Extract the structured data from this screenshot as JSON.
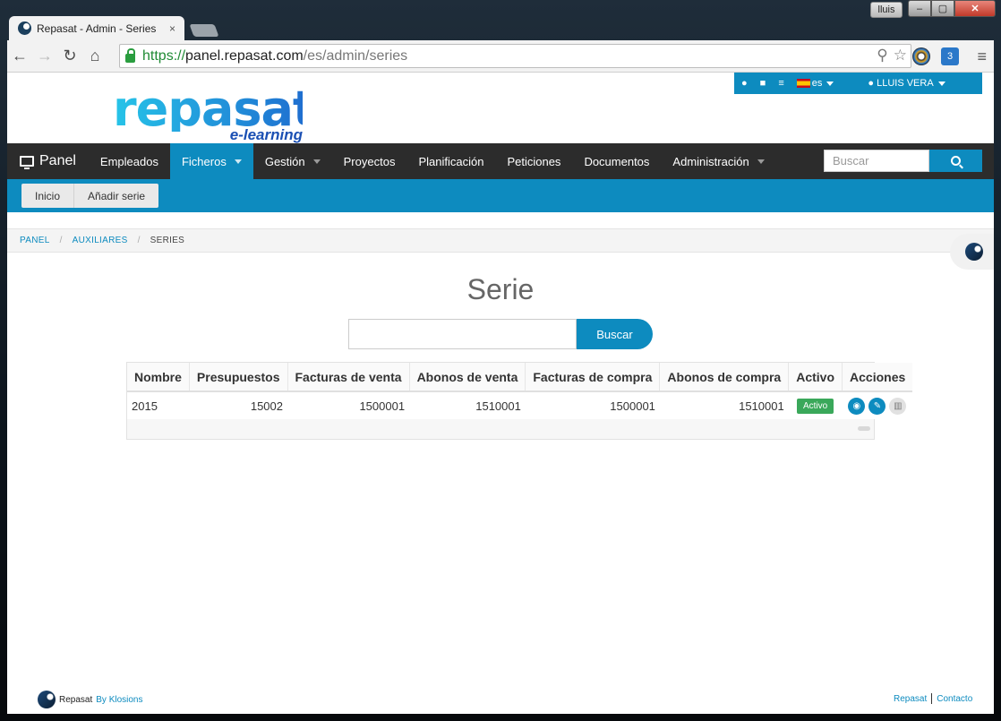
{
  "os": {
    "user_chip": "lluis",
    "window_buttons": {
      "minimize": "‒",
      "maximize": "▢",
      "close": "✕"
    }
  },
  "browser": {
    "tab_title": "Repasat - Admin - Series",
    "tab_close": "×",
    "url_scheme": "https://",
    "url_host": "panel.repasat.com",
    "url_path": "/es/admin/series",
    "ext2_label": "3"
  },
  "topbar": {
    "language": "es",
    "user_name": "LLUIS VERA"
  },
  "logo": {
    "word": "repasat",
    "sub": "e-learning"
  },
  "nav": {
    "brand": "Panel",
    "items": [
      {
        "label": "Empleados"
      },
      {
        "label": "Ficheros"
      },
      {
        "label": "Gestión"
      },
      {
        "label": "Proyectos"
      },
      {
        "label": "Planificación"
      },
      {
        "label": "Peticiones"
      },
      {
        "label": "Documentos"
      },
      {
        "label": "Administración"
      }
    ],
    "search_placeholder": "Buscar"
  },
  "subnav": {
    "home": "Inicio",
    "add": "Añadir serie"
  },
  "breadcrumb": {
    "items": [
      "PANEL",
      "AUXILIARES",
      "SERIES"
    ],
    "sep": "/"
  },
  "page": {
    "title": "Serie",
    "search_button": "Buscar"
  },
  "table": {
    "headers": [
      "Nombre",
      "Presupuestos",
      "Facturas de venta",
      "Abonos de venta",
      "Facturas de compra",
      "Abonos de compra",
      "Activo",
      "Acciones"
    ],
    "rows": [
      {
        "nombre": "2015",
        "presupuestos": "15002",
        "facturas_venta": "1500001",
        "abonos_venta": "1510001",
        "facturas_compra": "1500001",
        "abonos_compra": "1510001",
        "activo": "Activo"
      }
    ]
  },
  "footer": {
    "brand": "Repasat",
    "by": "By Klosions",
    "links": [
      "Repasat",
      "Contacto"
    ]
  },
  "colors": {
    "primary": "#0d8bbf",
    "nav_bg": "#2c2c2c",
    "badge_active": "#3aa85a"
  }
}
